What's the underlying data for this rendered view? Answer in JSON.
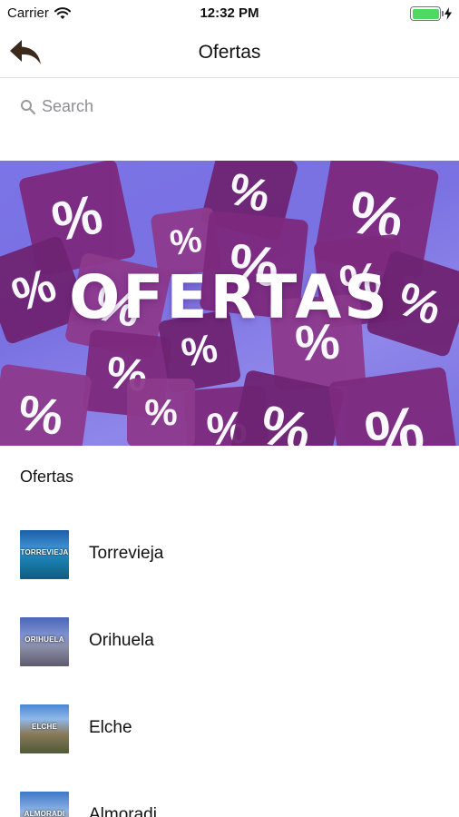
{
  "status_bar": {
    "carrier": "Carrier",
    "time": "12:32 PM",
    "battery_level": 1.0,
    "battery_color": "#4cd964"
  },
  "nav": {
    "title": "Ofertas",
    "back_icon": "back-arrow-icon"
  },
  "search": {
    "placeholder": "Search",
    "value": ""
  },
  "banner": {
    "text": "OFERTAS",
    "cube_symbol": "%",
    "background_color": "#7b74e6",
    "cube_color": "#7d2a7e"
  },
  "section": {
    "title": "Ofertas"
  },
  "items": [
    {
      "label": "Torrevieja",
      "thumb_label": "TORREVIEJA"
    },
    {
      "label": "Orihuela",
      "thumb_label": "ORIHUELA"
    },
    {
      "label": "Elche",
      "thumb_label": "ELCHE"
    },
    {
      "label": "Almoradi",
      "thumb_label": "ALMORADI"
    }
  ]
}
